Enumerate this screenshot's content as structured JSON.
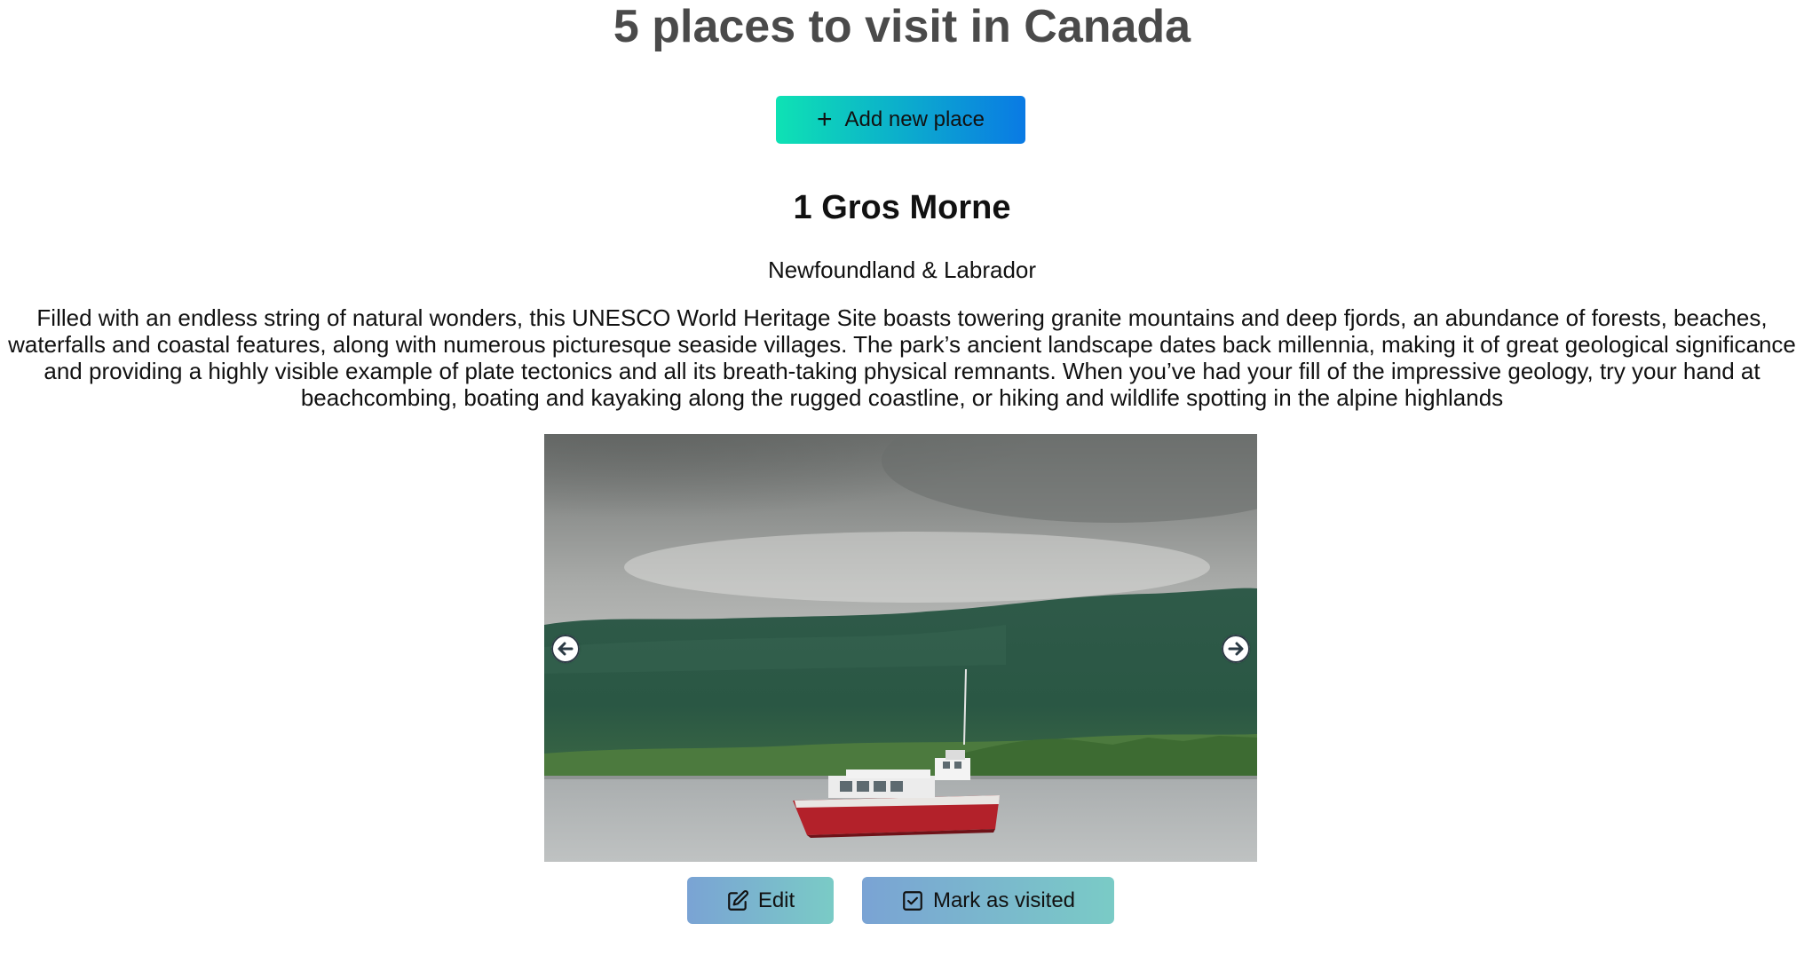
{
  "page": {
    "title": "5 places to visit in Canada"
  },
  "toolbar": {
    "add_label": "Add new place",
    "add_icon": "plus-icon"
  },
  "place": {
    "number": "1",
    "name": "Gros Morne",
    "title": "1 Gros Morne",
    "region": "Newfoundland & Labrador",
    "description": "Filled with an endless string of natural wonders, this UNESCO World Heritage Site boasts towering granite mountains and deep fjords, an abundance of forests, beaches, waterfalls and coastal features, along with numerous picturesque seaside villages. The park’s ancient landscape dates back millennia, making it of great geological significance and providing a highly visible example of plate tectonics and all its breath-taking physical remnants. When you’ve had your fill of the impressive geology, try your hand at beachcombing, boating and kayaking along the rugged coastline, or hiking and wildlife spotting in the alpine highlands",
    "image_alt": "Gros Morne"
  },
  "carousel": {
    "prev_icon": "arrow-left-icon",
    "next_icon": "arrow-right-icon"
  },
  "actions": {
    "edit_label": "Edit",
    "edit_icon": "edit-icon",
    "visited_label": "Mark as visited",
    "visited_icon": "checkbox-icon"
  },
  "colors": {
    "add_gradient_start": "#0ee2b4",
    "add_gradient_end": "#0a7ae4",
    "action_gradient_start": "#7aa3d4",
    "action_gradient_end": "#7acbc6",
    "title_color": "#4a4a4a"
  }
}
